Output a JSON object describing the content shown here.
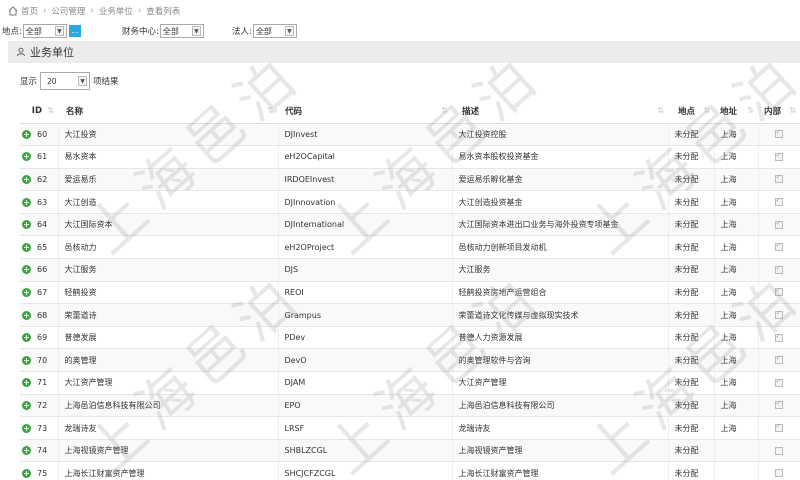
{
  "breadcrumb": [
    "首页",
    "公司管理",
    "业务单位",
    "查看列表"
  ],
  "filters": {
    "region": {
      "label": "地点:",
      "value": "全部"
    },
    "finance": {
      "label": "财务中心:",
      "value": "全部"
    },
    "legal": {
      "label": "法人:",
      "value": "全部"
    }
  },
  "panel": {
    "title": "业务单位"
  },
  "pagesize": {
    "prefix": "显示",
    "value": "20",
    "suffix": "项结果"
  },
  "columns": [
    "ID",
    "名称",
    "代码",
    "描述",
    "地点",
    "地址",
    "内部"
  ],
  "rows": [
    {
      "id": "60",
      "name": "大江投资",
      "code": "DJInvest",
      "desc": "大江投资控股",
      "place": "未分配",
      "addr": "上海",
      "internal": true
    },
    {
      "id": "61",
      "name": "易水资本",
      "code": "eH2OCapital",
      "desc": "易水资本股权投资基金",
      "place": "未分配",
      "addr": "上海",
      "internal": true
    },
    {
      "id": "62",
      "name": "爱运易乐",
      "code": "IRDOEInvest",
      "desc": "爱运易乐孵化基金",
      "place": "未分配",
      "addr": "上海",
      "internal": true
    },
    {
      "id": "63",
      "name": "大江创造",
      "code": "DJInnovation",
      "desc": "大江创造投资基金",
      "place": "未分配",
      "addr": "上海",
      "internal": true
    },
    {
      "id": "64",
      "name": "大江国际资本",
      "code": "DJInternational",
      "desc": "大江国际资本进出口业务与海外投资专项基金",
      "place": "未分配",
      "addr": "上海",
      "internal": true
    },
    {
      "id": "65",
      "name": "邑核动力",
      "code": "eH2OProject",
      "desc": "邑核动力创新项目发动机",
      "place": "未分配",
      "addr": "上海",
      "internal": true
    },
    {
      "id": "66",
      "name": "大江服务",
      "code": "DJS",
      "desc": "大江服务",
      "place": "未分配",
      "addr": "上海",
      "internal": true
    },
    {
      "id": "67",
      "name": "轻鹤投资",
      "code": "REOI",
      "desc": "轻鹤投资房地产运营组合",
      "place": "未分配",
      "addr": "上海",
      "internal": true
    },
    {
      "id": "68",
      "name": "荣蕾道诗",
      "code": "Grampus",
      "desc": "荣蕾道诗文化传媒与虚拟现实技术",
      "place": "未分配",
      "addr": "上海",
      "internal": true
    },
    {
      "id": "69",
      "name": "普德发展",
      "code": "PDev",
      "desc": "普德人力资源发展",
      "place": "未分配",
      "addr": "上海",
      "internal": true
    },
    {
      "id": "70",
      "name": "的奥管理",
      "code": "DevO",
      "desc": "的奥管理软件与咨询",
      "place": "未分配",
      "addr": "上海",
      "internal": true
    },
    {
      "id": "71",
      "name": "大江资产管理",
      "code": "DJAM",
      "desc": "大江资产管理",
      "place": "未分配",
      "addr": "上海",
      "internal": true
    },
    {
      "id": "72",
      "name": "上海邑泊信息科技有限公司",
      "code": "EPO",
      "desc": "上海邑泊信息科技有限公司",
      "place": "未分配",
      "addr": "上海",
      "internal": true
    },
    {
      "id": "73",
      "name": "龙瑞诗友",
      "code": "LRSF",
      "desc": "龙瑞诗友",
      "place": "未分配",
      "addr": "上海",
      "internal": true
    },
    {
      "id": "74",
      "name": "上海视镜资产管理",
      "code": "SHBLZCGL",
      "desc": "上海视镜资产管理",
      "place": "未分配",
      "addr": "",
      "internal": false
    },
    {
      "id": "75",
      "name": "上海长江财富资产管理",
      "code": "SHCJCFZCGL",
      "desc": "上海长江财富资产管理",
      "place": "未分配",
      "addr": "",
      "internal": false
    }
  ],
  "watermark": "上海邑泊",
  "colors": {
    "accent": "#29a9df",
    "plus": "#3aa53a",
    "header_bg": "#ececec"
  }
}
